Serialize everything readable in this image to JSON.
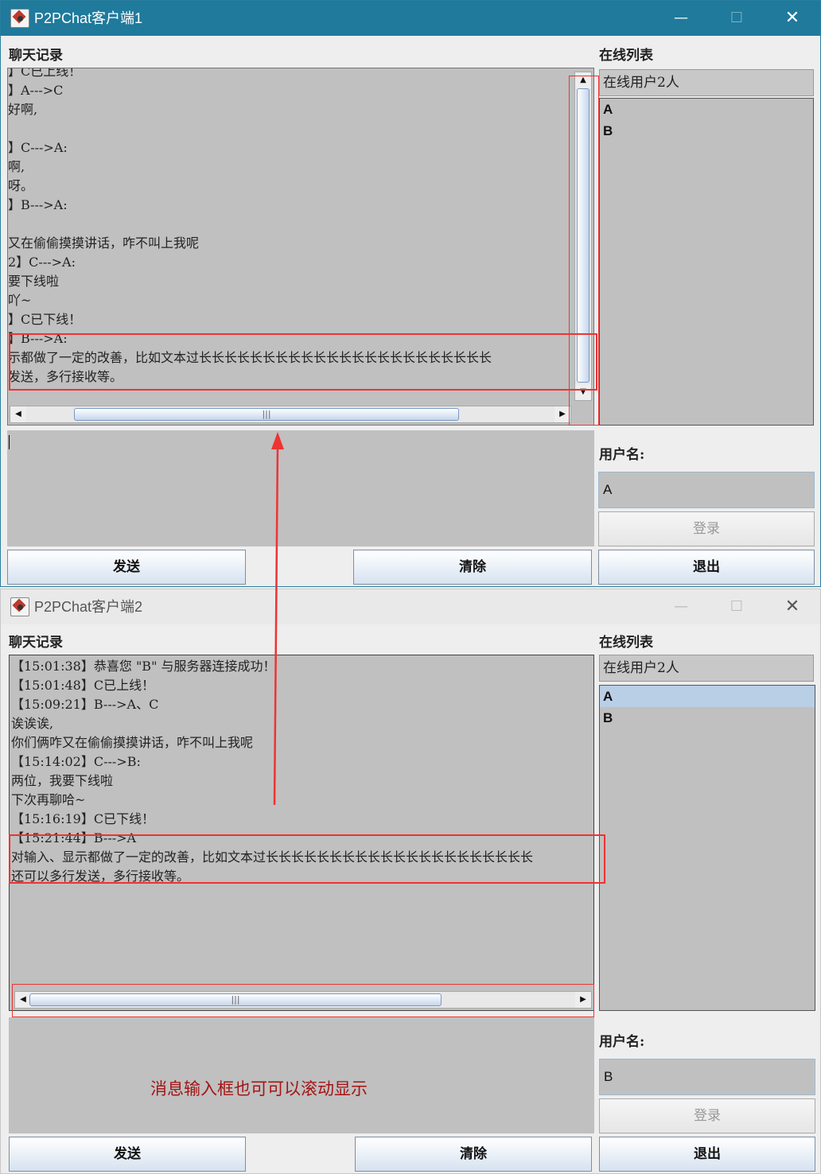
{
  "window1": {
    "title": "P2PChat客户端1",
    "chat_label": "聊天记录",
    "online_label": "在线列表",
    "online_count": "在线用户2人",
    "users": [
      "A",
      "B"
    ],
    "chat_lines": [
      "】C已上线！",
      "】A--->C",
      "好啊,",
      "",
      "】C--->A:",
      "啊,",
      "呀。",
      "】B--->A:",
      "",
      "又在偷偷摸摸讲话，咋不叫上我呢",
      "2】C--->A:",
      "要下线啦",
      "吖~",
      "】C已下线！",
      "】B--->A:",
      "示都做了一定的改善，比如文本过长长长长长长长长长长长长长长长长长长长长长长长",
      "发送，多行接收等。"
    ],
    "username_label": "用户名:",
    "username_value": "A",
    "login_button": "登录",
    "send_button": "发送",
    "clear_button": "清除",
    "exit_button": "退出"
  },
  "window2": {
    "title": "P2PChat客户端2",
    "chat_label": "聊天记录",
    "online_label": "在线列表",
    "online_count": "在线用户2人",
    "users": [
      "A",
      "B"
    ],
    "selected_user": "A",
    "chat_lines": [
      "【15:01:38】恭喜您 \"B\" 与服务器连接成功！",
      "【15:01:48】C已上线！",
      "【15:09:21】B--->A、C",
      "诶诶诶,",
      "你们俩咋又在偷偷摸摸讲话，咋不叫上我呢",
      "【15:14:02】C--->B:",
      "两位，我要下线啦",
      "下次再聊哈~",
      "【15:16:19】C已下线！",
      "【15:21:44】B--->A",
      "对输入、显示都做了一定的改善，比如文本过长长长长长长长长长长长长长长长长长长长长长",
      "还可以多行发送，多行接收等。"
    ],
    "username_label": "用户名:",
    "username_value": "B",
    "login_button": "登录",
    "send_button": "发送",
    "clear_button": "清除",
    "exit_button": "退出"
  },
  "annotation": {
    "text": "消息输入框也可可以滚动显示",
    "color": "#e33333"
  }
}
